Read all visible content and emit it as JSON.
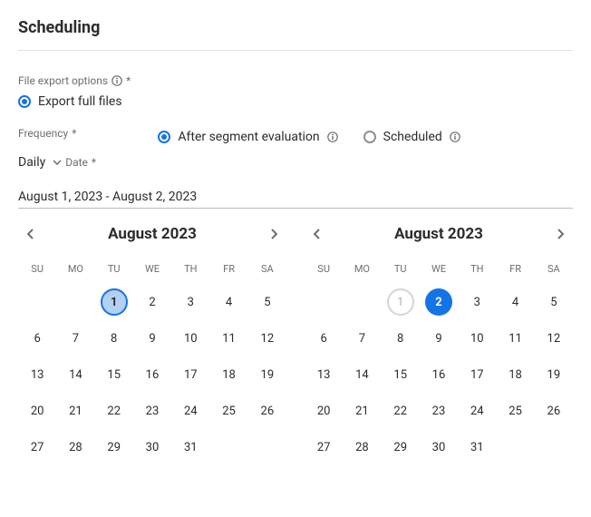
{
  "title": "Scheduling",
  "fileExport": {
    "label": "File export options",
    "required": "*",
    "option": "Export full files"
  },
  "frequency": {
    "label": "Frequency",
    "required": "*",
    "value": "Daily",
    "options": {
      "after": "After segment evaluation",
      "scheduled": "Scheduled"
    }
  },
  "date": {
    "label": "Date",
    "required": "*",
    "range": "August 1, 2023 - August 2, 2023"
  },
  "calLeft": {
    "month": "August 2023",
    "dow": {
      "su": "SU",
      "mo": "MO",
      "tu": "TU",
      "we": "WE",
      "th": "TH",
      "fr": "FR",
      "sa": "SA"
    },
    "days": {
      "d1": "1",
      "d2": "2",
      "d3": "3",
      "d4": "4",
      "d5": "5",
      "d6": "6",
      "d7": "7",
      "d8": "8",
      "d9": "9",
      "d10": "10",
      "d11": "11",
      "d12": "12",
      "d13": "13",
      "d14": "14",
      "d15": "15",
      "d16": "16",
      "d17": "17",
      "d18": "18",
      "d19": "19",
      "d20": "20",
      "d21": "21",
      "d22": "22",
      "d23": "23",
      "d24": "24",
      "d25": "25",
      "d26": "26",
      "d27": "27",
      "d28": "28",
      "d29": "29",
      "d30": "30",
      "d31": "31"
    }
  },
  "calRight": {
    "month": "August 2023",
    "dow": {
      "su": "SU",
      "mo": "MO",
      "tu": "TU",
      "we": "WE",
      "th": "TH",
      "fr": "FR",
      "sa": "SA"
    },
    "days": {
      "d1": "1",
      "d2": "2",
      "d3": "3",
      "d4": "4",
      "d5": "5",
      "d6": "6",
      "d7": "7",
      "d8": "8",
      "d9": "9",
      "d10": "10",
      "d11": "11",
      "d12": "12",
      "d13": "13",
      "d14": "14",
      "d15": "15",
      "d16": "16",
      "d17": "17",
      "d18": "18",
      "d19": "19",
      "d20": "20",
      "d21": "21",
      "d22": "22",
      "d23": "23",
      "d24": "24",
      "d25": "25",
      "d26": "26",
      "d27": "27",
      "d28": "28",
      "d29": "29",
      "d30": "30",
      "d31": "31"
    }
  }
}
